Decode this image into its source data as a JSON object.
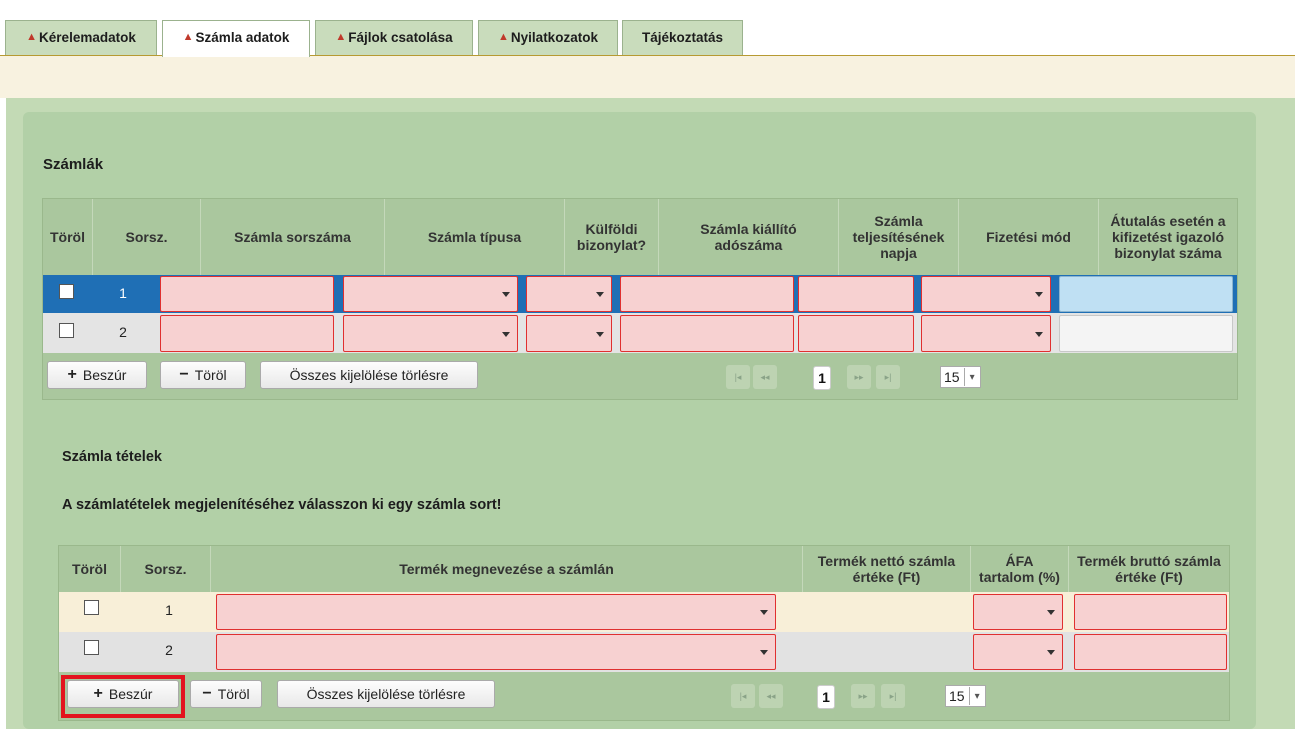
{
  "tabs": [
    {
      "label": "Kérelemadatok",
      "warn": true
    },
    {
      "label": "Számla adatok",
      "warn": true,
      "active": true
    },
    {
      "label": "Fájlok csatolása",
      "warn": true
    },
    {
      "label": "Nyilatkozatok",
      "warn": true
    },
    {
      "label": "Tájékoztatás",
      "warn": false
    }
  ],
  "warn_icon": "▲",
  "invoices": {
    "title": "Számlák",
    "headers": [
      "Töröl",
      "Sorsz.",
      "Számla sorszáma",
      "Számla típusa",
      "Külföldi bizonylat?",
      "Számla kiállító adószáma",
      "Számla teljesítésének napja",
      "Fizetési mód",
      "Átutalás esetén a kifizetést igazoló bizonylat száma"
    ],
    "rows": [
      {
        "num": "1",
        "selected": true
      },
      {
        "num": "2",
        "selected": false
      }
    ],
    "buttons": {
      "insert": "Beszúr",
      "delete": "Töröl",
      "select_all": "Összes kijelölése törlésre"
    },
    "pager": {
      "page": "1",
      "page_size": "15"
    }
  },
  "items": {
    "title": "Számla tételek",
    "hint": "A számlatételek megjelenítéséhez válasszon ki egy számla sort!",
    "headers": [
      "Töröl",
      "Sorsz.",
      "Termék megnevezése a számlán",
      "Termék nettó számla értéke (Ft)",
      "ÁFA tartalom (%)",
      "Termék bruttó számla értéke (Ft)"
    ],
    "rows": [
      {
        "num": "1"
      },
      {
        "num": "2"
      }
    ],
    "buttons": {
      "insert": "Beszúr",
      "delete": "Töröl",
      "select_all": "Összes kijelölése törlésre"
    },
    "pager": {
      "page": "1",
      "page_size": "15"
    }
  },
  "pager_icons": {
    "first": "|◂",
    "prev": "◂◂",
    "next": "▸▸",
    "last": "▸|"
  },
  "colors": {
    "required_fill": "#f7d1d1",
    "required_border": "#e03030",
    "selected_row": "#1f6fb5",
    "highlight": "#e3141e"
  }
}
